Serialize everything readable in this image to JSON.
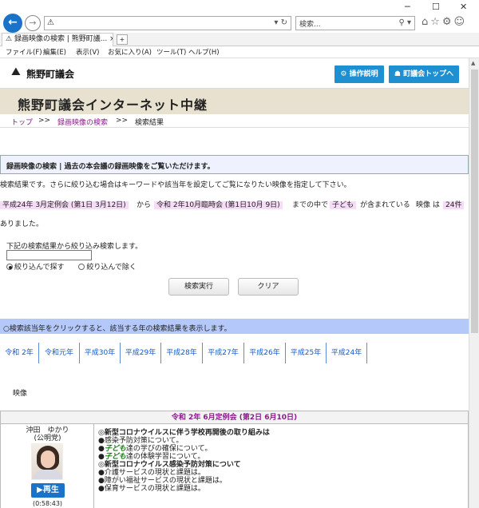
{
  "browser": {
    "address_text": "",
    "search_placeholder": "検索...",
    "tab_title": "録画映像の検索 | 熊野町議...",
    "window_minimize": "─",
    "window_maximize": "☐",
    "window_close": "✕",
    "toolbar_icons": "⌂☆⚙☺"
  },
  "menu": [
    "ファイル(F)",
    "編集(E)",
    "表示(V)",
    "お気に入り(A)",
    "ツール(T)",
    "ヘルプ(H)"
  ],
  "site": {
    "title": "熊野町議会",
    "btn_help": "⚙ 操作説明",
    "btn_top": "☗ 町議会トップへ",
    "banner": "熊野町議会インターネット中継"
  },
  "breadcrumb": {
    "top": "トップ",
    "sep": ">>",
    "search": "録画映像の検索",
    "current": "検索結果"
  },
  "notice": "録画映像の検索 | 過去の本会議の録画映像をご覧いただけます。",
  "description": "検索結果です。さらに絞り込む場合はキーワードや該当年を設定してご覧になりたい映像を指定して下さい。",
  "conditions": {
    "from": "平成24年 3月定例会 (第1日 3月12日)",
    "from_word": "から",
    "to": "令和 2年10月臨時会 (第1日10月 9日)",
    "to_word": "までの中で",
    "keyword": "子ども",
    "contains": "が含まれている",
    "video_word": "映像 は",
    "count": "24件",
    "end": "ありました。"
  },
  "refine": {
    "label": "下記の検索結果から絞り込み検索します。",
    "input_value": "",
    "radio_include": "絞り込んで探す",
    "radio_exclude": "絞り込んで除く",
    "search_button": "検索実行",
    "clear_button": "クリア"
  },
  "year_bar": "○検索該当年をクリックすると、該当する年の検索結果を表示します。",
  "years": [
    "令和 2年",
    "令和元年",
    "平成30年",
    "平成29年",
    "平成28年",
    "平成27年",
    "平成26年",
    "平成25年",
    "平成24年"
  ],
  "section_label": "映像",
  "result": {
    "header": "令和 2年 6月定例会 (第2日 6月10日)",
    "speaker_name": "沖田　ゆかり",
    "speaker_role": "(公明党)",
    "play_label": "▶再生",
    "duration": "(0:58:43)",
    "topics": [
      {
        "text": "◎新型コロナウイルスに伴う学校再開後の取り組みは",
        "main": true
      },
      {
        "pre": "●感染予防対策について。"
      },
      {
        "pre": "●",
        "kw": "子ども",
        "post": "達の学びの確保について。"
      },
      {
        "pre": "●",
        "kw": "子ども",
        "post": "達の体験学習について。"
      },
      {
        "text": "◎新型コロナウイルス感染予防対策について",
        "main": true
      },
      {
        "pre": "●介護サービスの現状と課題は。"
      },
      {
        "pre": "●障がい福祉サービスの現状と課題は。"
      },
      {
        "pre": "●保育サービスの現状と課題は。"
      }
    ]
  }
}
